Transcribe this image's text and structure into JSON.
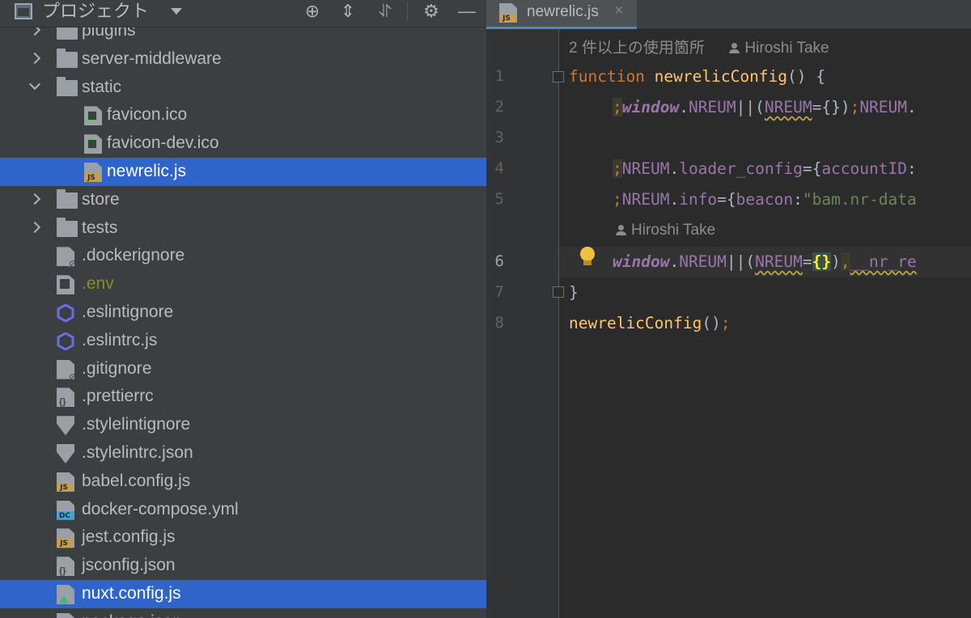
{
  "project": {
    "title": "プロジェクト",
    "items": [
      {
        "label": "plugins",
        "kind": "folder",
        "depth": 1,
        "expand": "closed"
      },
      {
        "label": "server-middleware",
        "kind": "folder",
        "depth": 1,
        "expand": "closed"
      },
      {
        "label": "static",
        "kind": "folder",
        "depth": 1,
        "expand": "open"
      },
      {
        "label": "favicon.ico",
        "kind": "image",
        "depth": 2,
        "expand": "none"
      },
      {
        "label": "favicon-dev.ico",
        "kind": "image",
        "depth": 2,
        "expand": "none"
      },
      {
        "label": "newrelic.js",
        "kind": "js",
        "depth": 2,
        "expand": "none",
        "selected": true
      },
      {
        "label": "store",
        "kind": "folder",
        "depth": 1,
        "expand": "closed"
      },
      {
        "label": "tests",
        "kind": "folder",
        "depth": 1,
        "expand": "closed"
      },
      {
        "label": ".dockerignore",
        "kind": "ignore",
        "depth": 1,
        "expand": "none"
      },
      {
        "label": ".env",
        "kind": "text",
        "depth": 1,
        "expand": "none"
      },
      {
        "label": ".eslintignore",
        "kind": "eslint",
        "depth": 1,
        "expand": "none"
      },
      {
        "label": ".eslintrc.js",
        "kind": "eslint",
        "depth": 1,
        "expand": "none"
      },
      {
        "label": ".gitignore",
        "kind": "ignore",
        "depth": 1,
        "expand": "none"
      },
      {
        "label": ".prettierrc",
        "kind": "json",
        "depth": 1,
        "expand": "none"
      },
      {
        "label": ".stylelintignore",
        "kind": "stylelint",
        "depth": 1,
        "expand": "none"
      },
      {
        "label": ".stylelintrc.json",
        "kind": "stylelint",
        "depth": 1,
        "expand": "none"
      },
      {
        "label": "babel.config.js",
        "kind": "js",
        "depth": 1,
        "expand": "none"
      },
      {
        "label": "docker-compose.yml",
        "kind": "docker",
        "depth": 1,
        "expand": "none"
      },
      {
        "label": "jest.config.js",
        "kind": "js",
        "depth": 1,
        "expand": "none"
      },
      {
        "label": "jsconfig.json",
        "kind": "json",
        "depth": 1,
        "expand": "none"
      },
      {
        "label": "nuxt.config.js",
        "kind": "nuxt",
        "depth": 1,
        "expand": "none",
        "selected": true
      },
      {
        "label": "package.json",
        "kind": "json",
        "depth": 1,
        "expand": "none"
      }
    ]
  },
  "editor": {
    "tab_label": "newrelic.js",
    "tab_close": "×",
    "usage_hint": "2 件以上の使用箇所",
    "author_top": "Hiroshi Take",
    "author_inline": "Hiroshi Take",
    "line_numbers": [
      "1",
      "2",
      "3",
      "4",
      "5",
      "6",
      "7",
      "8"
    ]
  },
  "colors": {
    "selection": "#2f65ca",
    "keyword": "#cc7832",
    "function": "#ffc66d",
    "variable": "#9876aa",
    "string": "#6a8759"
  }
}
